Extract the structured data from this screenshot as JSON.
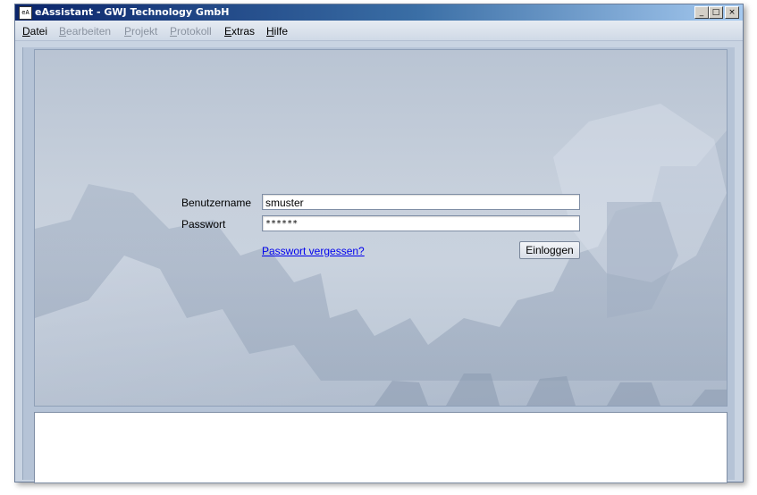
{
  "window": {
    "title": "eAssistant - GWJ Technology GmbH",
    "icon": "eA",
    "controls": {
      "minimize": "_",
      "maximize": "□",
      "close": "×"
    }
  },
  "menu": {
    "items": [
      {
        "label": "Datei",
        "enabled": true
      },
      {
        "label": "Bearbeiten",
        "enabled": false
      },
      {
        "label": "Projekt",
        "enabled": false
      },
      {
        "label": "Protokoll",
        "enabled": false
      },
      {
        "label": "Extras",
        "enabled": true
      },
      {
        "label": "Hilfe",
        "enabled": true
      }
    ]
  },
  "login": {
    "username_label": "Benutzername",
    "username_value": "smuster",
    "password_label": "Passwort",
    "password_value": "******",
    "forgot_link": "Passwort vergessen?",
    "login_button": "Einloggen"
  },
  "colors": {
    "titlebar_start": "#0a246a",
    "titlebar_end": "#a6caf0",
    "link": "#0000ee",
    "background": "#c9d4e2"
  }
}
